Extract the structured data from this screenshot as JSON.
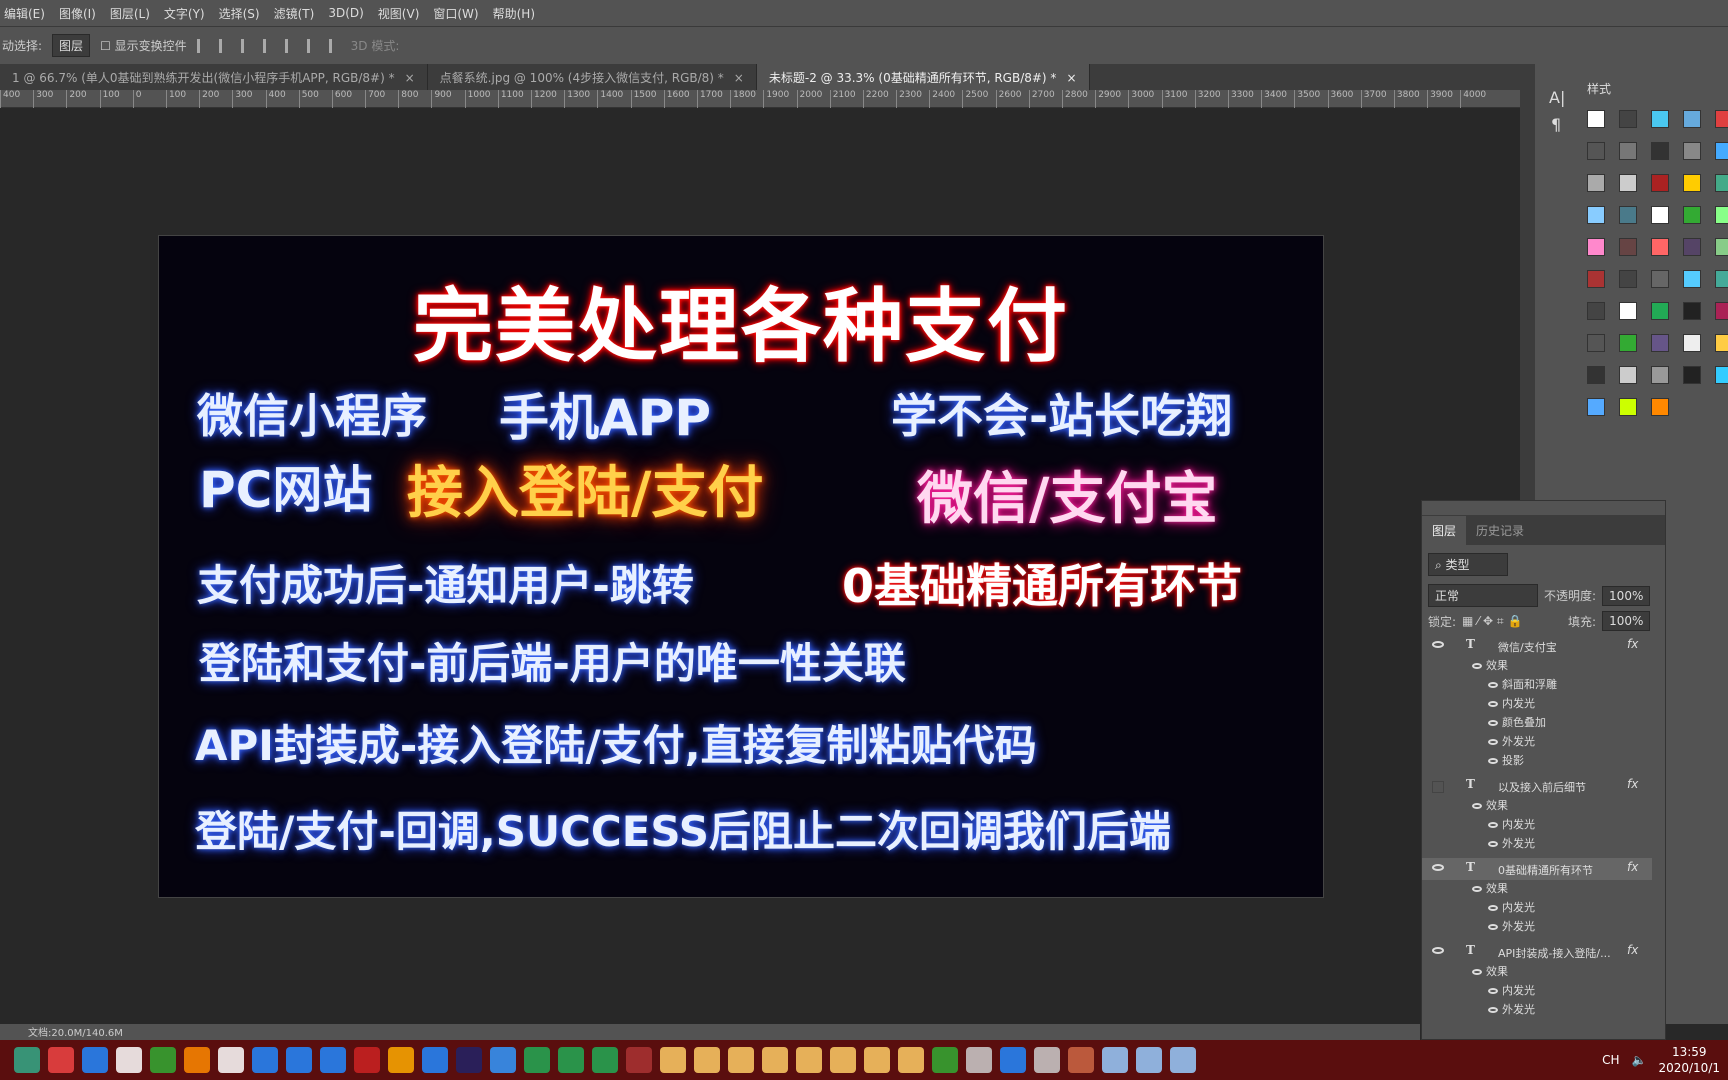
{
  "menu": [
    "编辑(E)",
    "图像(I)",
    "图层(L)",
    "文字(Y)",
    "选择(S)",
    "滤镜(T)",
    "3D(D)",
    "视图(V)",
    "窗口(W)",
    "帮助(H)"
  ],
  "options": {
    "auto_select": "动选择:",
    "layer_select": "图层",
    "show_transform": "显示变换控件",
    "mode_3d": "3D 模式:"
  },
  "tabs": [
    {
      "label": "1 @ 66.7% (单人0基础到熟练开发出(微信小程序手机APP, RGB/8#) *",
      "active": false
    },
    {
      "label": "点餐系统.jpg @ 100% (4步接入微信支付, RGB/8) *",
      "active": false
    },
    {
      "label": "未标题-2 @ 33.3% (0基础精通所有环节, RGB/8#) *",
      "active": true
    }
  ],
  "ruler": [
    "400",
    "300",
    "200",
    "100",
    "0",
    "100",
    "200",
    "300",
    "400",
    "500",
    "600",
    "700",
    "800",
    "900",
    "1000",
    "1100",
    "1200",
    "1300",
    "1400",
    "1500",
    "1600",
    "1700",
    "1800",
    "1900",
    "2000",
    "2100",
    "2200",
    "2300",
    "2400",
    "2500",
    "2600",
    "2700",
    "2800",
    "2900",
    "3000",
    "3100",
    "3200",
    "3300",
    "3400",
    "3500",
    "3600",
    "3700",
    "3800",
    "3900",
    "4000"
  ],
  "canvas": {
    "title": "完美处理各种支付",
    "l1a": "微信小程序",
    "l1b": "手机APP",
    "l1c": "学不会-站长吃翔",
    "l2a": "PC网站",
    "l2b": "接入登陆/支付",
    "l2c": "微信/支付宝",
    "l3a": "支付成功后-通知用户-跳转",
    "l3b": "0基础精通所有环节",
    "l4": "登陆和支付-前后端-用户的唯一性关联",
    "l5": "API封装成-接入登陆/支付,直接复制粘贴代码",
    "l6": "登陆/支付-回调,SUCCESS后阻止二次回调我们后端"
  },
  "styles_panel": {
    "tab": "样式"
  },
  "layers_panel": {
    "tabs": [
      "图层",
      "历史记录"
    ],
    "filter": "类型",
    "blend": "正常",
    "opacity_label": "不透明度:",
    "opacity": "100%",
    "lock_label": "锁定:",
    "fill_label": "填充:",
    "fill": "100%",
    "layers": [
      {
        "name": "微信/支付宝",
        "visible": true,
        "effects": [
          "斜面和浮雕",
          "内发光",
          "颜色叠加",
          "外发光",
          "投影"
        ]
      },
      {
        "name": "以及接入前后细节",
        "visible": false,
        "effects": [
          "内发光",
          "外发光"
        ]
      },
      {
        "name": "0基础精通所有环节",
        "visible": true,
        "selected": true,
        "effects": [
          "内发光",
          "外发光"
        ]
      },
      {
        "name": "API封装成-接入登陆/...",
        "visible": true,
        "effects": [
          "内发光",
          "外发光"
        ]
      }
    ],
    "effects_label": "效果",
    "fx": "fx"
  },
  "status": {
    "doc": "文档:20.0M/140.6M"
  },
  "tray": {
    "lang": "CH",
    "time": "13:59",
    "date": "2020/10/1"
  }
}
